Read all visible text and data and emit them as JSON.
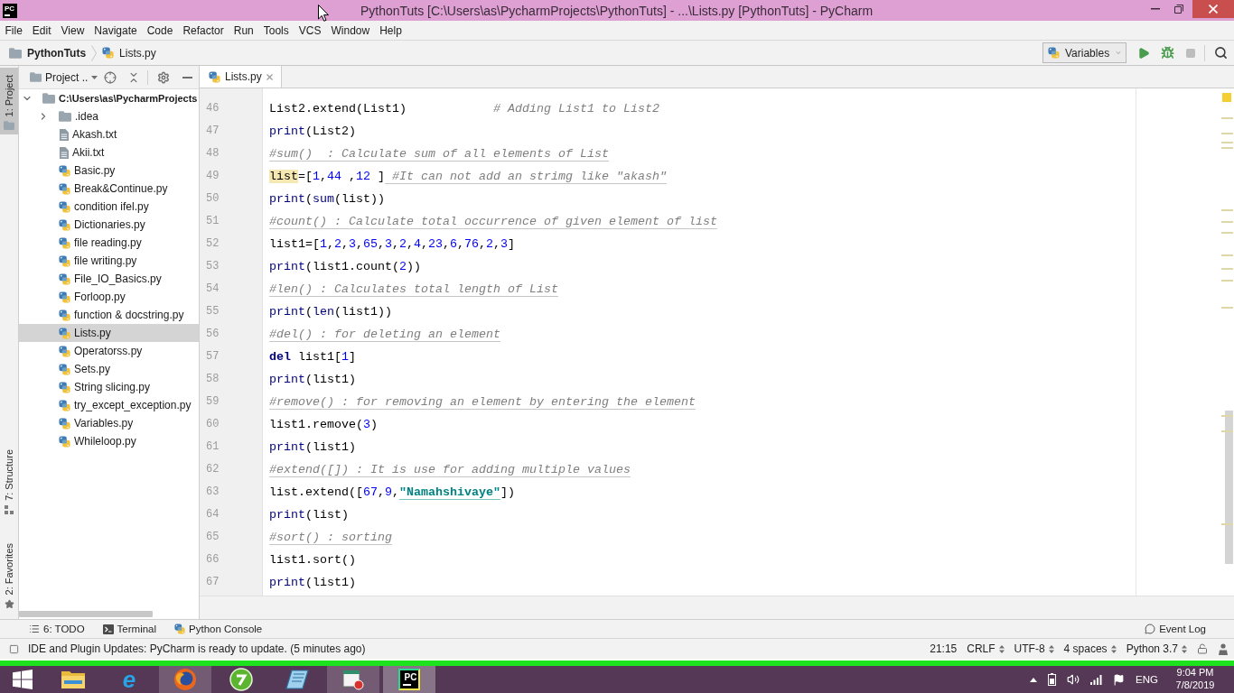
{
  "window": {
    "logo": "PC",
    "title": "PythonTuts [C:\\Users\\as\\PycharmProjects\\PythonTuts] - ...\\Lists.py [PythonTuts] - PyCharm"
  },
  "menu": [
    "File",
    "Edit",
    "View",
    "Navigate",
    "Code",
    "Refactor",
    "Run",
    "Tools",
    "VCS",
    "Window",
    "Help"
  ],
  "navigation": {
    "breadcrumbs": [
      {
        "kind": "folder",
        "label": "PythonTuts"
      },
      {
        "kind": "python",
        "label": "Lists.py"
      }
    ],
    "run_config": "Variables"
  },
  "tool_strip": {
    "top": [
      {
        "kind": "project",
        "label": "1: Project",
        "selected": true
      }
    ],
    "bottom": [
      {
        "kind": "structure",
        "label": "7: Structure",
        "selected": false
      },
      {
        "kind": "favorites",
        "label": "2: Favorites",
        "selected": false
      }
    ]
  },
  "project_panel": {
    "view": "Project ..",
    "tree": [
      {
        "label": "C:\\Users\\as\\PycharmProjects",
        "kind": "folder",
        "expanded": true,
        "selected": false,
        "children": [
          {
            "label": ".idea",
            "kind": "folder",
            "expanded": false,
            "selected": false
          },
          {
            "label": "Akash.txt",
            "kind": "text",
            "selected": false
          },
          {
            "label": "Akii.txt",
            "kind": "text",
            "selected": false
          },
          {
            "label": "Basic.py",
            "kind": "python",
            "selected": false
          },
          {
            "label": "Break&Continue.py",
            "kind": "python",
            "selected": false
          },
          {
            "label": "condition ifel.py",
            "kind": "python",
            "selected": false
          },
          {
            "label": "Dictionaries.py",
            "kind": "python",
            "selected": false
          },
          {
            "label": "file reading.py",
            "kind": "python",
            "selected": false
          },
          {
            "label": "file writing.py",
            "kind": "python",
            "selected": false
          },
          {
            "label": "File_IO_Basics.py",
            "kind": "python",
            "selected": false
          },
          {
            "label": "Forloop.py",
            "kind": "python",
            "selected": false
          },
          {
            "label": "function & docstring.py",
            "kind": "python",
            "selected": false
          },
          {
            "label": "Lists.py",
            "kind": "python",
            "selected": true
          },
          {
            "label": "Operatorss.py",
            "kind": "python",
            "selected": false
          },
          {
            "label": "Sets.py",
            "kind": "python",
            "selected": false
          },
          {
            "label": "String slicing.py",
            "kind": "python",
            "selected": false
          },
          {
            "label": "try_except_exception.py",
            "kind": "python",
            "selected": false
          },
          {
            "label": "Variables.py",
            "kind": "python",
            "selected": false
          },
          {
            "label": "Whileloop.py",
            "kind": "python",
            "selected": false
          }
        ]
      }
    ]
  },
  "editor": {
    "tabs": [
      {
        "label": "Lists.py",
        "selected": true
      }
    ],
    "lines": [
      {
        "number": "46",
        "tokens": [
          {
            "kind": "text",
            "text": "List2.extend(List1)            "
          },
          {
            "kind": "comment",
            "text": "# Adding List1 to List2"
          }
        ]
      },
      {
        "number": "47",
        "tokens": [
          {
            "kind": "builtin",
            "text": "print"
          },
          {
            "kind": "text",
            "text": "(List2)"
          }
        ]
      },
      {
        "number": "48",
        "tokens": [
          {
            "kind": "lintcomment",
            "text": "#sum()  : Calculate sum of all elements of List"
          }
        ]
      },
      {
        "number": "49",
        "tokens": [
          {
            "kind": "shadowed",
            "text": "list"
          },
          {
            "kind": "text",
            "text": "=["
          },
          {
            "kind": "number",
            "text": "1"
          },
          {
            "kind": "text",
            "text": ","
          },
          {
            "kind": "number",
            "text": "44"
          },
          {
            "kind": "text",
            "text": " ,"
          },
          {
            "kind": "number",
            "text": "12"
          },
          {
            "kind": "text",
            "text": " ]"
          },
          {
            "kind": "lintcomment",
            "text": " #It can not add an strimg like \"akash\""
          }
        ]
      },
      {
        "number": "50",
        "tokens": [
          {
            "kind": "builtin",
            "text": "print"
          },
          {
            "kind": "text",
            "text": "("
          },
          {
            "kind": "builtin",
            "text": "sum"
          },
          {
            "kind": "text",
            "text": "(list))"
          }
        ]
      },
      {
        "number": "51",
        "tokens": [
          {
            "kind": "lintcomment",
            "text": "#count() : Calculate total occurrence of given element of list"
          }
        ]
      },
      {
        "number": "52",
        "tokens": [
          {
            "kind": "text",
            "text": "list1=["
          },
          {
            "kind": "number",
            "text": "1"
          },
          {
            "kind": "text",
            "text": ","
          },
          {
            "kind": "number",
            "text": "2"
          },
          {
            "kind": "text",
            "text": ","
          },
          {
            "kind": "number",
            "text": "3"
          },
          {
            "kind": "text",
            "text": ","
          },
          {
            "kind": "number",
            "text": "65"
          },
          {
            "kind": "text",
            "text": ","
          },
          {
            "kind": "number",
            "text": "3"
          },
          {
            "kind": "text",
            "text": ","
          },
          {
            "kind": "number",
            "text": "2"
          },
          {
            "kind": "text",
            "text": ","
          },
          {
            "kind": "number",
            "text": "4"
          },
          {
            "kind": "text",
            "text": ","
          },
          {
            "kind": "number",
            "text": "23"
          },
          {
            "kind": "text",
            "text": ","
          },
          {
            "kind": "number",
            "text": "6"
          },
          {
            "kind": "text",
            "text": ","
          },
          {
            "kind": "number",
            "text": "76"
          },
          {
            "kind": "text",
            "text": ","
          },
          {
            "kind": "number",
            "text": "2"
          },
          {
            "kind": "text",
            "text": ","
          },
          {
            "kind": "number",
            "text": "3"
          },
          {
            "kind": "text",
            "text": "]"
          }
        ]
      },
      {
        "number": "53",
        "tokens": [
          {
            "kind": "builtin",
            "text": "print"
          },
          {
            "kind": "text",
            "text": "(list1.count("
          },
          {
            "kind": "number",
            "text": "2"
          },
          {
            "kind": "text",
            "text": "))"
          }
        ]
      },
      {
        "number": "54",
        "tokens": [
          {
            "kind": "lintcomment",
            "text": "#len() : Calculates total length of List"
          }
        ]
      },
      {
        "number": "55",
        "tokens": [
          {
            "kind": "builtin",
            "text": "print"
          },
          {
            "kind": "text",
            "text": "("
          },
          {
            "kind": "builtin",
            "text": "len"
          },
          {
            "kind": "text",
            "text": "(list1))"
          }
        ]
      },
      {
        "number": "56",
        "tokens": [
          {
            "kind": "lintcomment",
            "text": "#del() : for deleting an element"
          }
        ]
      },
      {
        "number": "57",
        "tokens": [
          {
            "kind": "keyword",
            "text": "del"
          },
          {
            "kind": "text",
            "text": " list1["
          },
          {
            "kind": "number",
            "text": "1"
          },
          {
            "kind": "text",
            "text": "]"
          }
        ]
      },
      {
        "number": "58",
        "tokens": [
          {
            "kind": "builtin",
            "text": "print"
          },
          {
            "kind": "text",
            "text": "(list1)"
          }
        ]
      },
      {
        "number": "59",
        "tokens": [
          {
            "kind": "lintcomment",
            "text": "#remove() : for removing an element by entering the element"
          }
        ]
      },
      {
        "number": "60",
        "tokens": [
          {
            "kind": "text",
            "text": "list1.remove("
          },
          {
            "kind": "number",
            "text": "3"
          },
          {
            "kind": "text",
            "text": ")"
          }
        ]
      },
      {
        "number": "61",
        "tokens": [
          {
            "kind": "builtin",
            "text": "print"
          },
          {
            "kind": "text",
            "text": "(list1)"
          }
        ]
      },
      {
        "number": "62",
        "tokens": [
          {
            "kind": "lintcomment",
            "text": "#extend([]) : It is use for adding multiple values"
          }
        ]
      },
      {
        "number": "63",
        "tokens": [
          {
            "kind": "text",
            "text": "list.extend(["
          },
          {
            "kind": "number",
            "text": "67"
          },
          {
            "kind": "text",
            "text": ","
          },
          {
            "kind": "number",
            "text": "9"
          },
          {
            "kind": "text",
            "text": ","
          },
          {
            "kind": "typostring",
            "text": "\"Namahshivaye\""
          },
          {
            "kind": "text",
            "text": "])"
          }
        ]
      },
      {
        "number": "64",
        "tokens": [
          {
            "kind": "builtin",
            "text": "print"
          },
          {
            "kind": "text",
            "text": "(list)"
          }
        ]
      },
      {
        "number": "65",
        "tokens": [
          {
            "kind": "lintcomment",
            "text": "#sort() : sorting"
          }
        ]
      },
      {
        "number": "66",
        "tokens": [
          {
            "kind": "text",
            "text": "list1.sort()"
          }
        ]
      },
      {
        "number": "67",
        "tokens": [
          {
            "kind": "builtin",
            "text": "print"
          },
          {
            "kind": "text",
            "text": "(list1)"
          }
        ]
      }
    ]
  },
  "tool_windows": {
    "left": [
      {
        "kind": "todo",
        "label": "6: TODO"
      },
      {
        "kind": "terminal",
        "label": "Terminal"
      },
      {
        "kind": "console",
        "label": "Python Console"
      }
    ],
    "right": [
      {
        "kind": "log",
        "label": "Event Log"
      }
    ]
  },
  "status_bar": {
    "message": "IDE and Plugin Updates: PyCharm is ready to update. (5 minutes ago)",
    "items": [
      {
        "label": "21:15",
        "dropdown": false
      },
      {
        "label": "CRLF",
        "dropdown": true
      },
      {
        "label": "UTF-8",
        "dropdown": true
      },
      {
        "label": "4 spaces",
        "dropdown": true
      },
      {
        "label": "Python 3.7",
        "dropdown": true
      }
    ]
  },
  "taskbar": {
    "apps": [
      {
        "kind": "files",
        "running": false,
        "selected": false
      },
      {
        "kind": "web",
        "label": "e",
        "running": false,
        "selected": false
      },
      {
        "kind": "fox",
        "running": true,
        "selected": false
      },
      {
        "kind": "green",
        "running": false,
        "selected": false
      },
      {
        "kind": "pen",
        "running": false,
        "selected": false
      },
      {
        "kind": "media",
        "running": true,
        "selected": false
      },
      {
        "kind": "ide",
        "label": "PC",
        "running": true,
        "selected": true
      }
    ],
    "tray": {
      "language": "ENG",
      "time": "9:04 PM",
      "date": "7/8/2019"
    }
  }
}
